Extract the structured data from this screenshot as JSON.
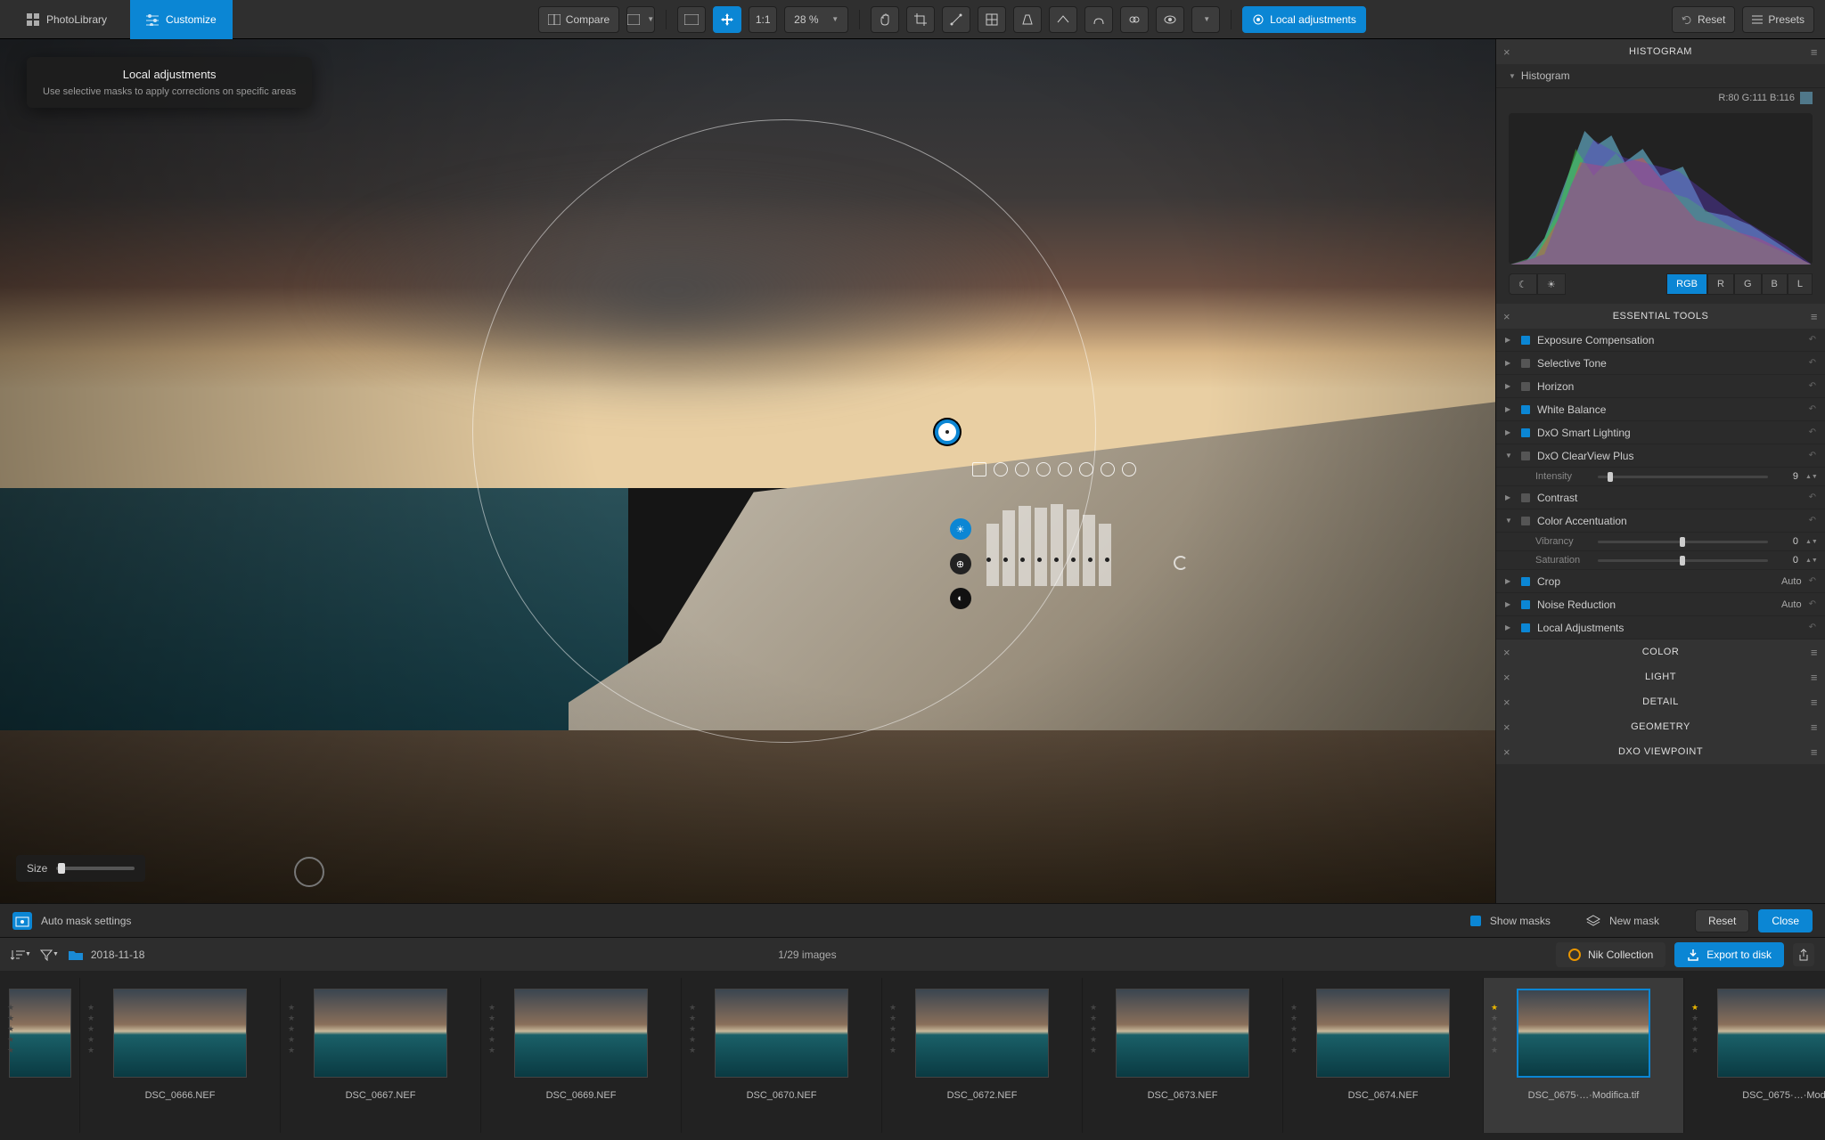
{
  "topbar": {
    "photolibrary": "PhotoLibrary",
    "customize": "Customize",
    "compare": "Compare",
    "ratio": "1:1",
    "zoom": "28 %",
    "local_adjustments": "Local adjustments",
    "reset": "Reset",
    "presets": "Presets"
  },
  "tooltip": {
    "title": "Local adjustments",
    "body": "Use selective masks to apply corrections on specific areas"
  },
  "size_label": "Size",
  "maskbar": {
    "auto": "Auto mask settings",
    "show": "Show masks",
    "new": "New mask",
    "reset": "Reset",
    "close": "Close"
  },
  "histogram": {
    "title": "HISTOGRAM",
    "sub": "Histogram",
    "readout": "R:80 G:111 B:116",
    "channels": [
      "RGB",
      "R",
      "G",
      "B",
      "L"
    ]
  },
  "panels": {
    "essential": "ESSENTIAL TOOLS",
    "color": "COLOR",
    "light": "LIGHT",
    "detail": "DETAIL",
    "geometry": "GEOMETRY",
    "viewpoint": "DXO VIEWPOINT"
  },
  "tools": {
    "exposure": "Exposure Compensation",
    "selective": "Selective Tone",
    "horizon": "Horizon",
    "wb": "White Balance",
    "smart": "DxO Smart Lighting",
    "clearview": "DxO ClearView Plus",
    "intensity": "Intensity",
    "intensity_val": "9",
    "contrast": "Contrast",
    "coloracc": "Color Accentuation",
    "vibrancy": "Vibrancy",
    "vibrancy_val": "0",
    "saturation": "Saturation",
    "saturation_val": "0",
    "crop": "Crop",
    "crop_val": "Auto",
    "noise": "Noise Reduction",
    "noise_val": "Auto",
    "local": "Local Adjustments"
  },
  "filmstrip": {
    "folder": "2018-11-18",
    "count": "1/29 images",
    "nik": "Nik Collection",
    "export": "Export to disk",
    "thumbs": [
      {
        "name": ""
      },
      {
        "name": "DSC_0666.NEF"
      },
      {
        "name": "DSC_0667.NEF"
      },
      {
        "name": "DSC_0669.NEF"
      },
      {
        "name": "DSC_0670.NEF"
      },
      {
        "name": "DSC_0672.NEF"
      },
      {
        "name": "DSC_0673.NEF"
      },
      {
        "name": "DSC_0674.NEF"
      },
      {
        "name": "DSC_0675·…·Modifica.tif",
        "sel": true,
        "star": true
      },
      {
        "name": "DSC_0675·…·Mod",
        "star": true
      }
    ]
  }
}
